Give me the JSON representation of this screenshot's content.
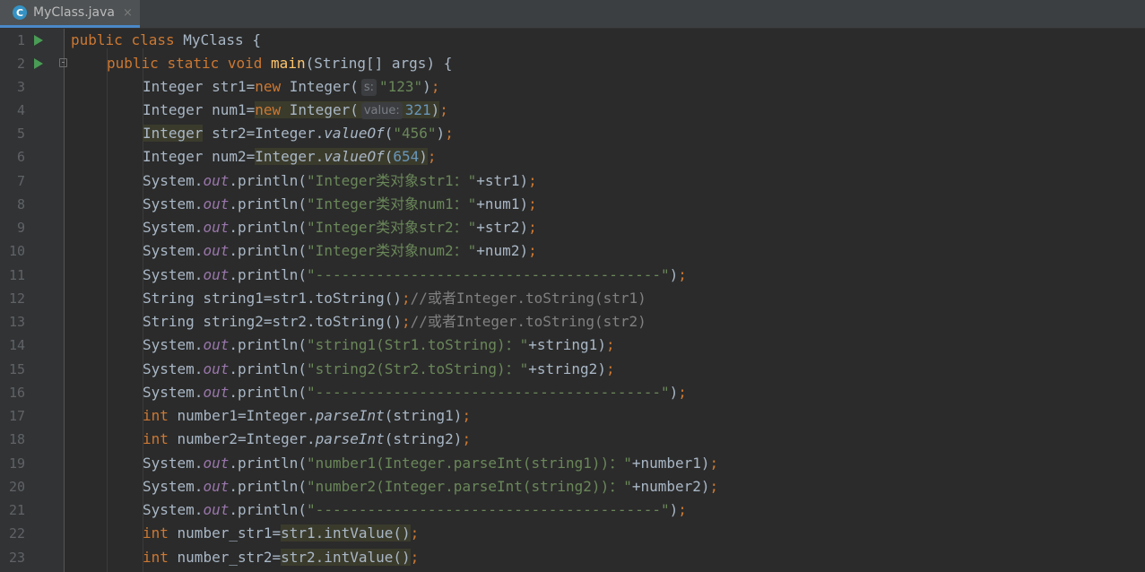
{
  "tab": {
    "filename": "MyClass.java",
    "icon": "java-class-icon",
    "icon_glyph": "C",
    "close_glyph": "×",
    "accent": "#4a88c7"
  },
  "hints": {
    "s": "s:",
    "value": "value:"
  },
  "lines": {
    "l1": {
      "num": "1",
      "kw1": "public",
      "kw2": "class",
      "rest": "MyClass {"
    },
    "l2": {
      "num": "2",
      "kw1": "public",
      "kw2": "static",
      "kw3": "void",
      "fn": "main",
      "rest": "(String[] args) {"
    },
    "l3": {
      "num": "3",
      "a": "Integer str1=",
      "kw": "new",
      "b": "Integer(",
      "str": "\"123\"",
      "c": ")",
      "semi": ";"
    },
    "l4": {
      "num": "4",
      "a": "Integer num1=",
      "kw": "new",
      "b": "Integer(",
      "n": "321",
      "c": ")",
      "semi": ";"
    },
    "l5": {
      "num": "5",
      "a": "Integer",
      "b": " str2=Integer.",
      "m": "valueOf",
      "c": "(",
      "str": "\"456\"",
      "d": ")",
      "semi": ";"
    },
    "l6": {
      "num": "6",
      "a": "Integer num2=",
      "b": "Integer.",
      "m": "valueOf",
      "c": "(",
      "n": "654",
      "d": ")",
      "semi": ";"
    },
    "l7": {
      "num": "7",
      "a": "System.",
      "f": "out",
      "b": ".println(",
      "str": "\"Integer类对象str1：\"",
      "c": "+str1)",
      "semi": ";"
    },
    "l8": {
      "num": "8",
      "a": "System.",
      "f": "out",
      "b": ".println(",
      "str": "\"Integer类对象num1：\"",
      "c": "+num1)",
      "semi": ";"
    },
    "l9": {
      "num": "9",
      "a": "System.",
      "f": "out",
      "b": ".println(",
      "str": "\"Integer类对象str2：\"",
      "c": "+str2)",
      "semi": ";"
    },
    "l10": {
      "num": "10",
      "a": "System.",
      "f": "out",
      "b": ".println(",
      "str": "\"Integer类对象num2：\"",
      "c": "+num2)",
      "semi": ";"
    },
    "l11": {
      "num": "11",
      "a": "System.",
      "f": "out",
      "b": ".println(",
      "str": "\"----------------------------------------\"",
      "c": ")",
      "semi": ";"
    },
    "l12": {
      "num": "12",
      "a": "String string1=str1.toString()",
      "semi": ";",
      "cm": "//或者Integer.toString(str1)"
    },
    "l13": {
      "num": "13",
      "a": "String string2=str2.toString()",
      "semi": ";",
      "cm": "//或者Integer.toString(str2)"
    },
    "l14": {
      "num": "14",
      "a": "System.",
      "f": "out",
      "b": ".println(",
      "str": "\"string1(Str1.toString)：\"",
      "c": "+string1)",
      "semi": ";"
    },
    "l15": {
      "num": "15",
      "a": "System.",
      "f": "out",
      "b": ".println(",
      "str": "\"string2(Str2.toString)：\"",
      "c": "+string2)",
      "semi": ";"
    },
    "l16": {
      "num": "16",
      "a": "System.",
      "f": "out",
      "b": ".println(",
      "str": "\"----------------------------------------\"",
      "c": ")",
      "semi": ";"
    },
    "l17": {
      "num": "17",
      "kw": "int",
      "a": " number1=Integer.",
      "m": "parseInt",
      "b": "(string1)",
      "semi": ";"
    },
    "l18": {
      "num": "18",
      "kw": "int",
      "a": " number2=Integer.",
      "m": "parseInt",
      "b": "(string2)",
      "semi": ";"
    },
    "l19": {
      "num": "19",
      "a": "System.",
      "f": "out",
      "b": ".println(",
      "str": "\"number1(Integer.parseInt(string1))：\"",
      "c": "+number1)",
      "semi": ";"
    },
    "l20": {
      "num": "20",
      "a": "System.",
      "f": "out",
      "b": ".println(",
      "str": "\"number2(Integer.parseInt(string2))：\"",
      "c": "+number2)",
      "semi": ";"
    },
    "l21": {
      "num": "21",
      "a": "System.",
      "f": "out",
      "b": ".println(",
      "str": "\"----------------------------------------\"",
      "c": ")",
      "semi": ";"
    },
    "l22": {
      "num": "22",
      "kw": "int",
      "a": " number_str1=",
      "b": "str1.intValue()",
      "semi": ";"
    },
    "l23": {
      "num": "23",
      "kw": "int",
      "a": " number_str2=",
      "b": "str2.intValue()",
      "semi": ";"
    }
  }
}
